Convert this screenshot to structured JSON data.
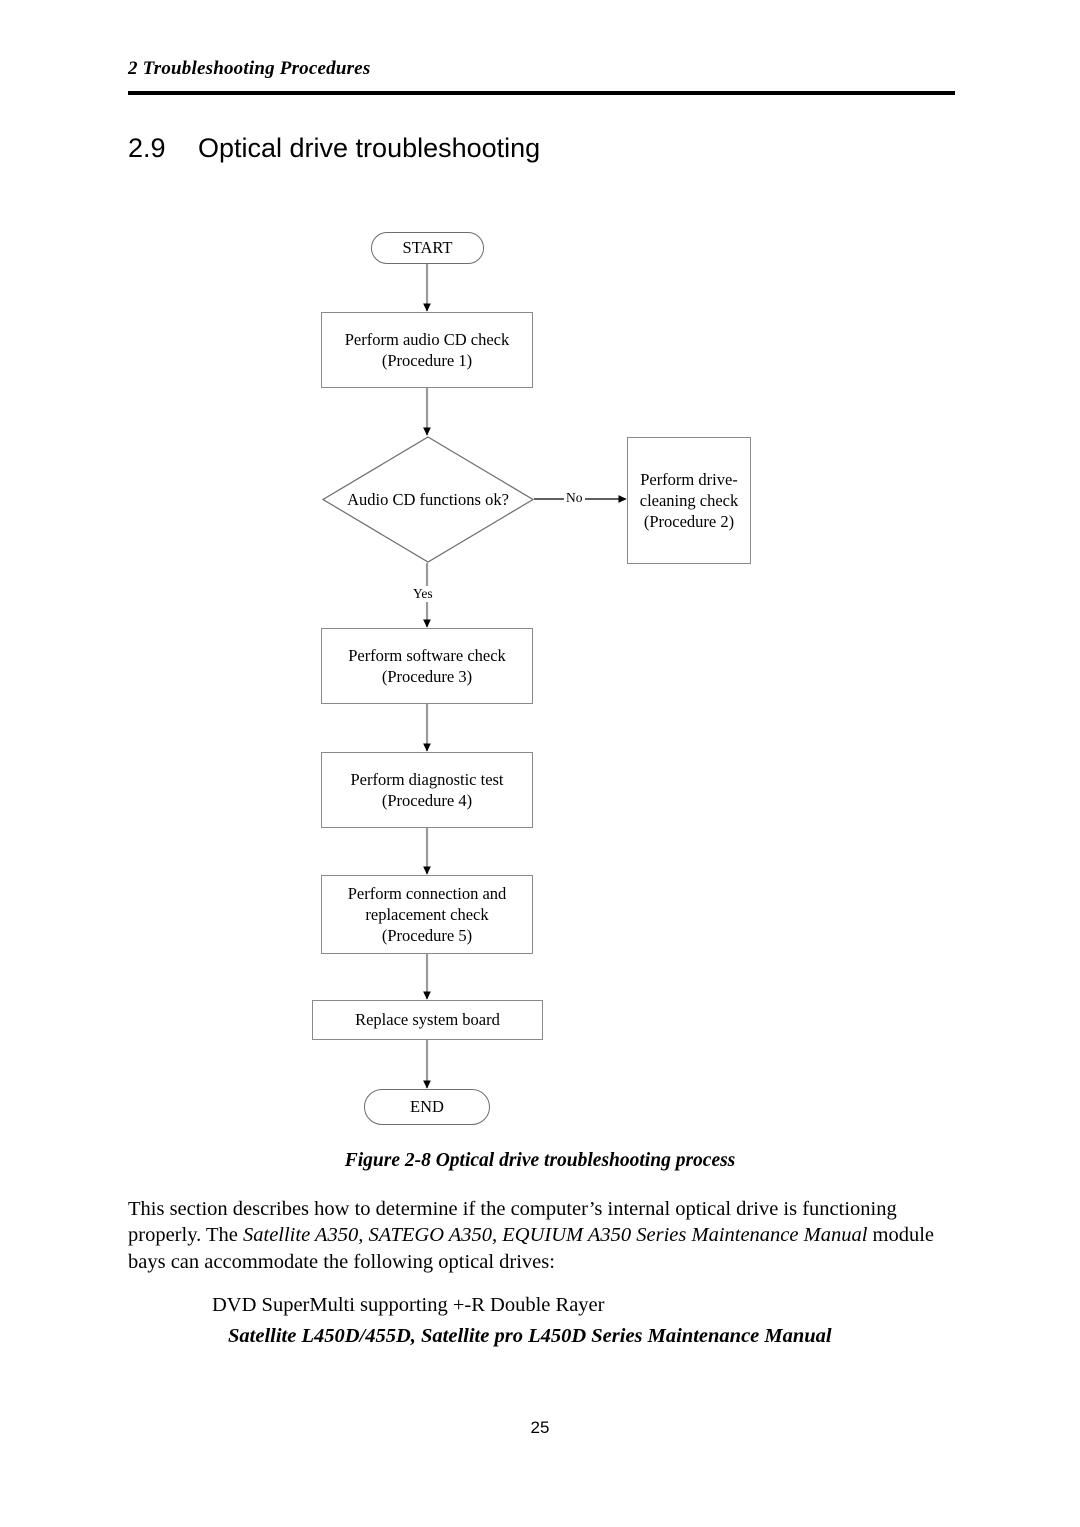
{
  "page": {
    "running_header": "2 Troubleshooting Procedures",
    "section_number": "2.9",
    "section_title": "Optical drive troubleshooting",
    "figure_caption": "Figure 2-8 Optical drive troubleshooting process",
    "page_number": "25"
  },
  "flowchart": {
    "start": "START",
    "end": "END",
    "nodes": [
      {
        "id": "audio-cd-check",
        "line1": "Perform audio CD check",
        "line2": "(Procedure 1)"
      },
      {
        "id": "drive-cleaning-check",
        "line1": "Perform drive-",
        "line2": "cleaning check",
        "line3": "(Procedure 2)"
      },
      {
        "id": "software-check",
        "line1": "Perform software check",
        "line2": "(Procedure 3)"
      },
      {
        "id": "diagnostic-test",
        "line1": "Perform diagnostic test",
        "line2": "(Procedure 4)"
      },
      {
        "id": "connection-replacement-check",
        "line1": "Perform connection and",
        "line2": "replacement check",
        "line3": "(Procedure 5)"
      },
      {
        "id": "replace-system-board",
        "line1": "Replace system board"
      }
    ],
    "decision": {
      "id": "audio-cd-functions-ok",
      "label": "Audio CD functions ok?"
    },
    "edge_labels": {
      "no": "No",
      "yes": "Yes"
    }
  },
  "body": {
    "paragraph_part1": "This section describes how to determine if the computer’s internal optical drive is functioning properly. The ",
    "paragraph_italic": "Satellite A350, SATEGO A350, EQUIUM A350 Series Maintenance Manual",
    "paragraph_part2": " module bays can accommodate the following optical drives:",
    "drive_line": "DVD SuperMulti supporting +-R Double Rayer",
    "manual_line": "Satellite L450D/455D, Satellite pro L450D Series Maintenance Manual"
  }
}
